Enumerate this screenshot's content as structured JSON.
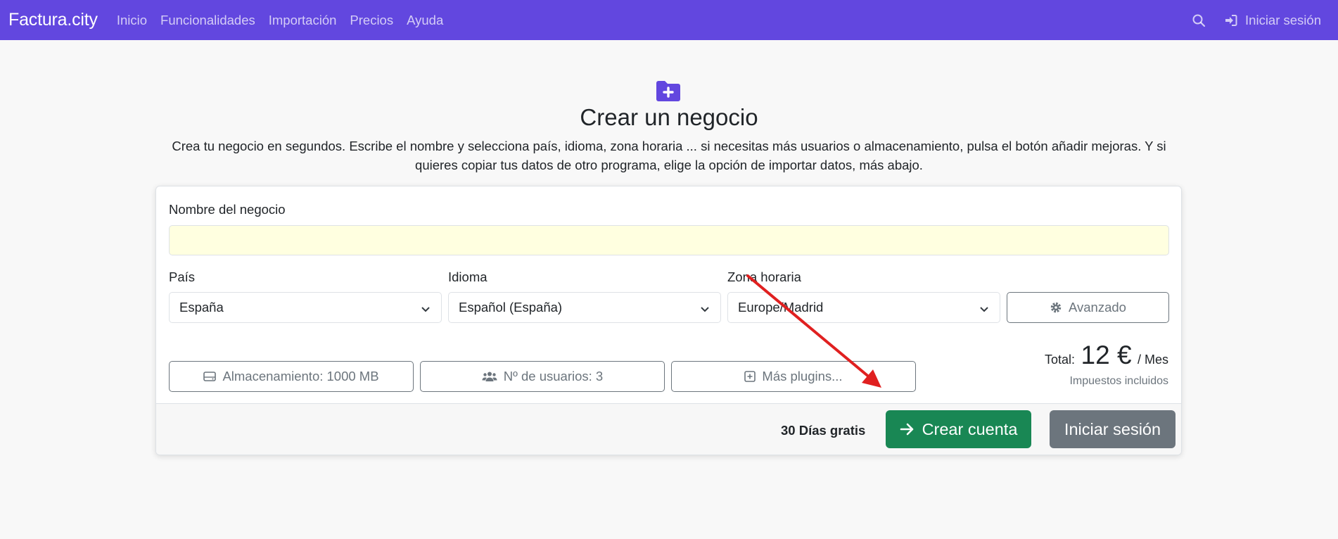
{
  "navbar": {
    "brand": "Factura.city",
    "links": [
      "Inicio",
      "Funcionalidades",
      "Importación",
      "Precios",
      "Ayuda"
    ],
    "search_icon": "search-icon",
    "login_label": "Iniciar sesión",
    "login_icon": "sign-in-icon"
  },
  "header": {
    "icon": "folder-plus-icon",
    "title": "Crear un negocio",
    "description": "Crea tu negocio en segundos. Escribe el nombre y selecciona país, idioma, zona horaria ... si necesitas más usuarios o almacenamiento, pulsa el botón añadir mejoras. Y si quieres copiar tus datos de otro programa, elige la opción de importar datos, más abajo."
  },
  "form": {
    "name_label": "Nombre del negocio",
    "name_value": "",
    "country_label": "País",
    "country_value": "España",
    "language_label": "Idioma",
    "language_value": "Español (España)",
    "timezone_label": "Zona horaria",
    "timezone_value": "Europe/Madrid",
    "advanced_label": "Avanzado",
    "storage_label": "Almacenamiento: 1000 MB",
    "users_label": "Nº de usuarios: 3",
    "plugins_label": "Más plugins..."
  },
  "pricing": {
    "total_label": "Total:",
    "amount": "12 €",
    "period": "/ Mes",
    "taxes": "Impuestos incluidos"
  },
  "footer": {
    "trial": "30 Días gratis",
    "create_label": "Crear cuenta",
    "login_label": "Iniciar sesión"
  },
  "colors": {
    "brand": "#6247df",
    "success": "#198754",
    "secondary": "#6c757d",
    "annotation": "#e02020"
  }
}
